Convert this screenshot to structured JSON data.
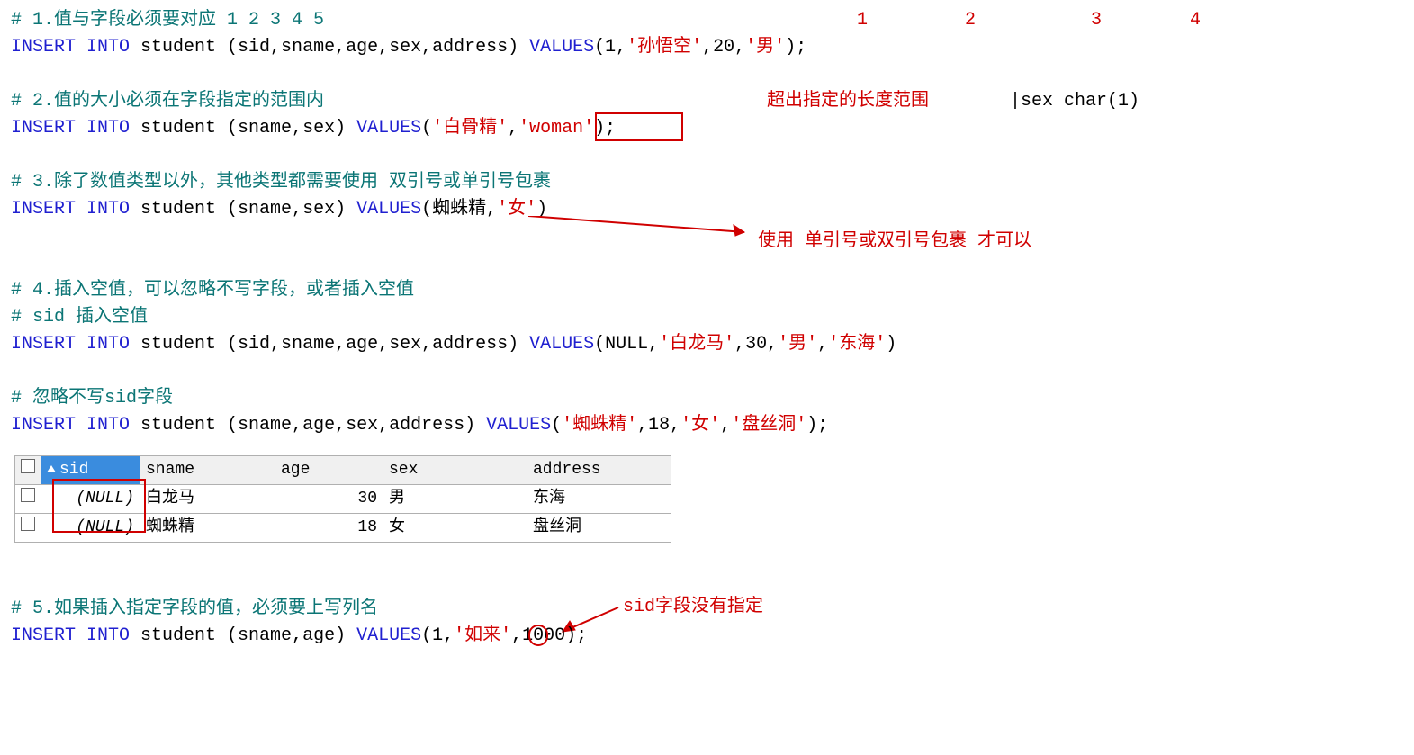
{
  "sec1": {
    "comment": "# 1.值与字段必须要对应 1   2    3   4    5",
    "t1": "1",
    "t2": "2",
    "t3": "3",
    "t4": "4",
    "kw1": "INSERT INTO",
    "code1": " student (sid,sname,age,sex,address) ",
    "kw2": "VALUES",
    "code2": "(1,",
    "s1": "'孙悟空'",
    "code3": ",20,",
    "s2": "'男'",
    "code4": ");"
  },
  "sec2": {
    "comment": "# 2.值的大小必须在字段指定的范围内",
    "annot": "超出指定的长度范围",
    "cursor": "|sex     char(1)",
    "kw1": "INSERT INTO",
    "code1": " student (sname,sex) ",
    "kw2": "VALUES",
    "code2": "(",
    "s1": "'白骨精'",
    "code3": ",",
    "s2": "'woman'",
    "code4": ");"
  },
  "sec3": {
    "comment": "# 3.除了数值类型以外，其他类型都需要使用 双引号或单引号包裹",
    "kw1": "INSERT INTO",
    "code1": " student (sname,sex) ",
    "kw2": "VALUES",
    "code2": "(蜘蛛精,",
    "s1": "'女'",
    "code3": ")",
    "annot": "使用 单引号或双引号包裹 才可以"
  },
  "sec4": {
    "c1": "# 4.插入空值，可以忽略不写字段，或者插入空值",
    "c2": "# sid 插入空值",
    "kw1": "INSERT INTO",
    "code1": " student (sid,sname,age,sex,address) ",
    "kw2": "VALUES",
    "code2": "(NULL,",
    "s1": "'白龙马'",
    "code3": ",30,",
    "s2": "'男'",
    "code4": ",",
    "s3": "'东海'",
    "code5": ")",
    "c3": "# 忽略不写sid字段",
    "kw3": "INSERT INTO",
    "code6": " student (sname,age,sex,address) ",
    "kw4": "VALUES",
    "code7": "(",
    "s4": "'蜘蛛精'",
    "code8": ",18,",
    "s5": "'女'",
    "code9": ",",
    "s6": "'盘丝洞'",
    "code10": ");"
  },
  "table": {
    "h1": "sid",
    "h2": "sname",
    "h3": "age",
    "h4": "sex",
    "h5": "address",
    "rows": [
      {
        "sid": "(NULL)",
        "sname": "白龙马",
        "age": "30",
        "sex": "男",
        "address": "东海"
      },
      {
        "sid": "(NULL)",
        "sname": "蜘蛛精",
        "age": "18",
        "sex": "女",
        "address": "盘丝洞"
      }
    ]
  },
  "sec5": {
    "comment": "# 5.如果插入指定字段的值，必须要上写列名",
    "annot": "sid字段没有指定",
    "kw1": "INSERT INTO",
    "code1": " student (sname,age) ",
    "kw2": "VALUES",
    "code2": "(1,",
    "s1": "'如来'",
    "code3": ",1000);"
  }
}
